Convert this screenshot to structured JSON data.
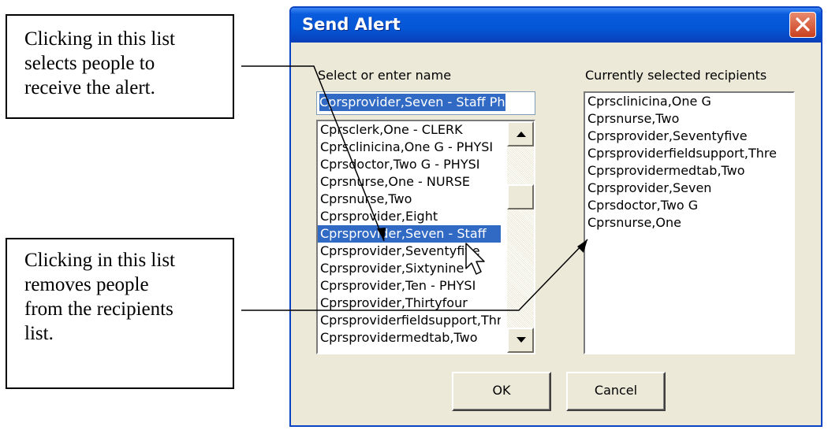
{
  "callouts": {
    "top": [
      "Clicking in this list",
      "selects people to",
      "receive the alert."
    ],
    "bottom": [
      "Clicking in this list",
      "removes people",
      "from the recipients",
      "list."
    ]
  },
  "dialog": {
    "title": "Send Alert",
    "select_label": "Select or enter name",
    "recipients_label": "Currently selected recipients",
    "name_input_value": "Cprsprovider,Seven - Staff Ph",
    "people_list": [
      "Cprsclerk,One - CLERK",
      "Cprsclinicina,One G - PHYSI",
      "Cprsdoctor,Two G - PHYSI",
      "Cprsnurse,One - NURSE",
      "Cprsnurse,Two",
      "Cprsprovider,Eight",
      "Cprsprovider,Seven - Staff",
      "Cprsprovider,Seventyfive",
      "Cprsprovider,Sixtynine",
      "Cprsprovider,Ten - PHYSI",
      "Cprsprovider,Thirtyfour",
      "Cprsproviderfieldsupport,Thr",
      "Cprsprovidermedtab,Two"
    ],
    "selected_person": "Cprsprovider,Seven - Staff",
    "recipients": [
      "Cprsclinicina,One G",
      "Cprsnurse,Two",
      "Cprsprovider,Seventyfive",
      "Cprsproviderfieldsupport,Thre",
      "Cprsprovidermedtab,Two",
      "Cprsprovider,Seven",
      "Cprsdoctor,Two G",
      "Cprsnurse,One"
    ],
    "ok_label": "OK",
    "cancel_label": "Cancel"
  },
  "icons": {
    "close": "close-icon",
    "scroll_up": "arrow-up-icon",
    "scroll_down": "arrow-down-icon",
    "cursor": "mouse-pointer-icon"
  },
  "colors": {
    "title_bar": "#0356d6",
    "selection": "#316ac5",
    "close_button": "#c9401e"
  }
}
